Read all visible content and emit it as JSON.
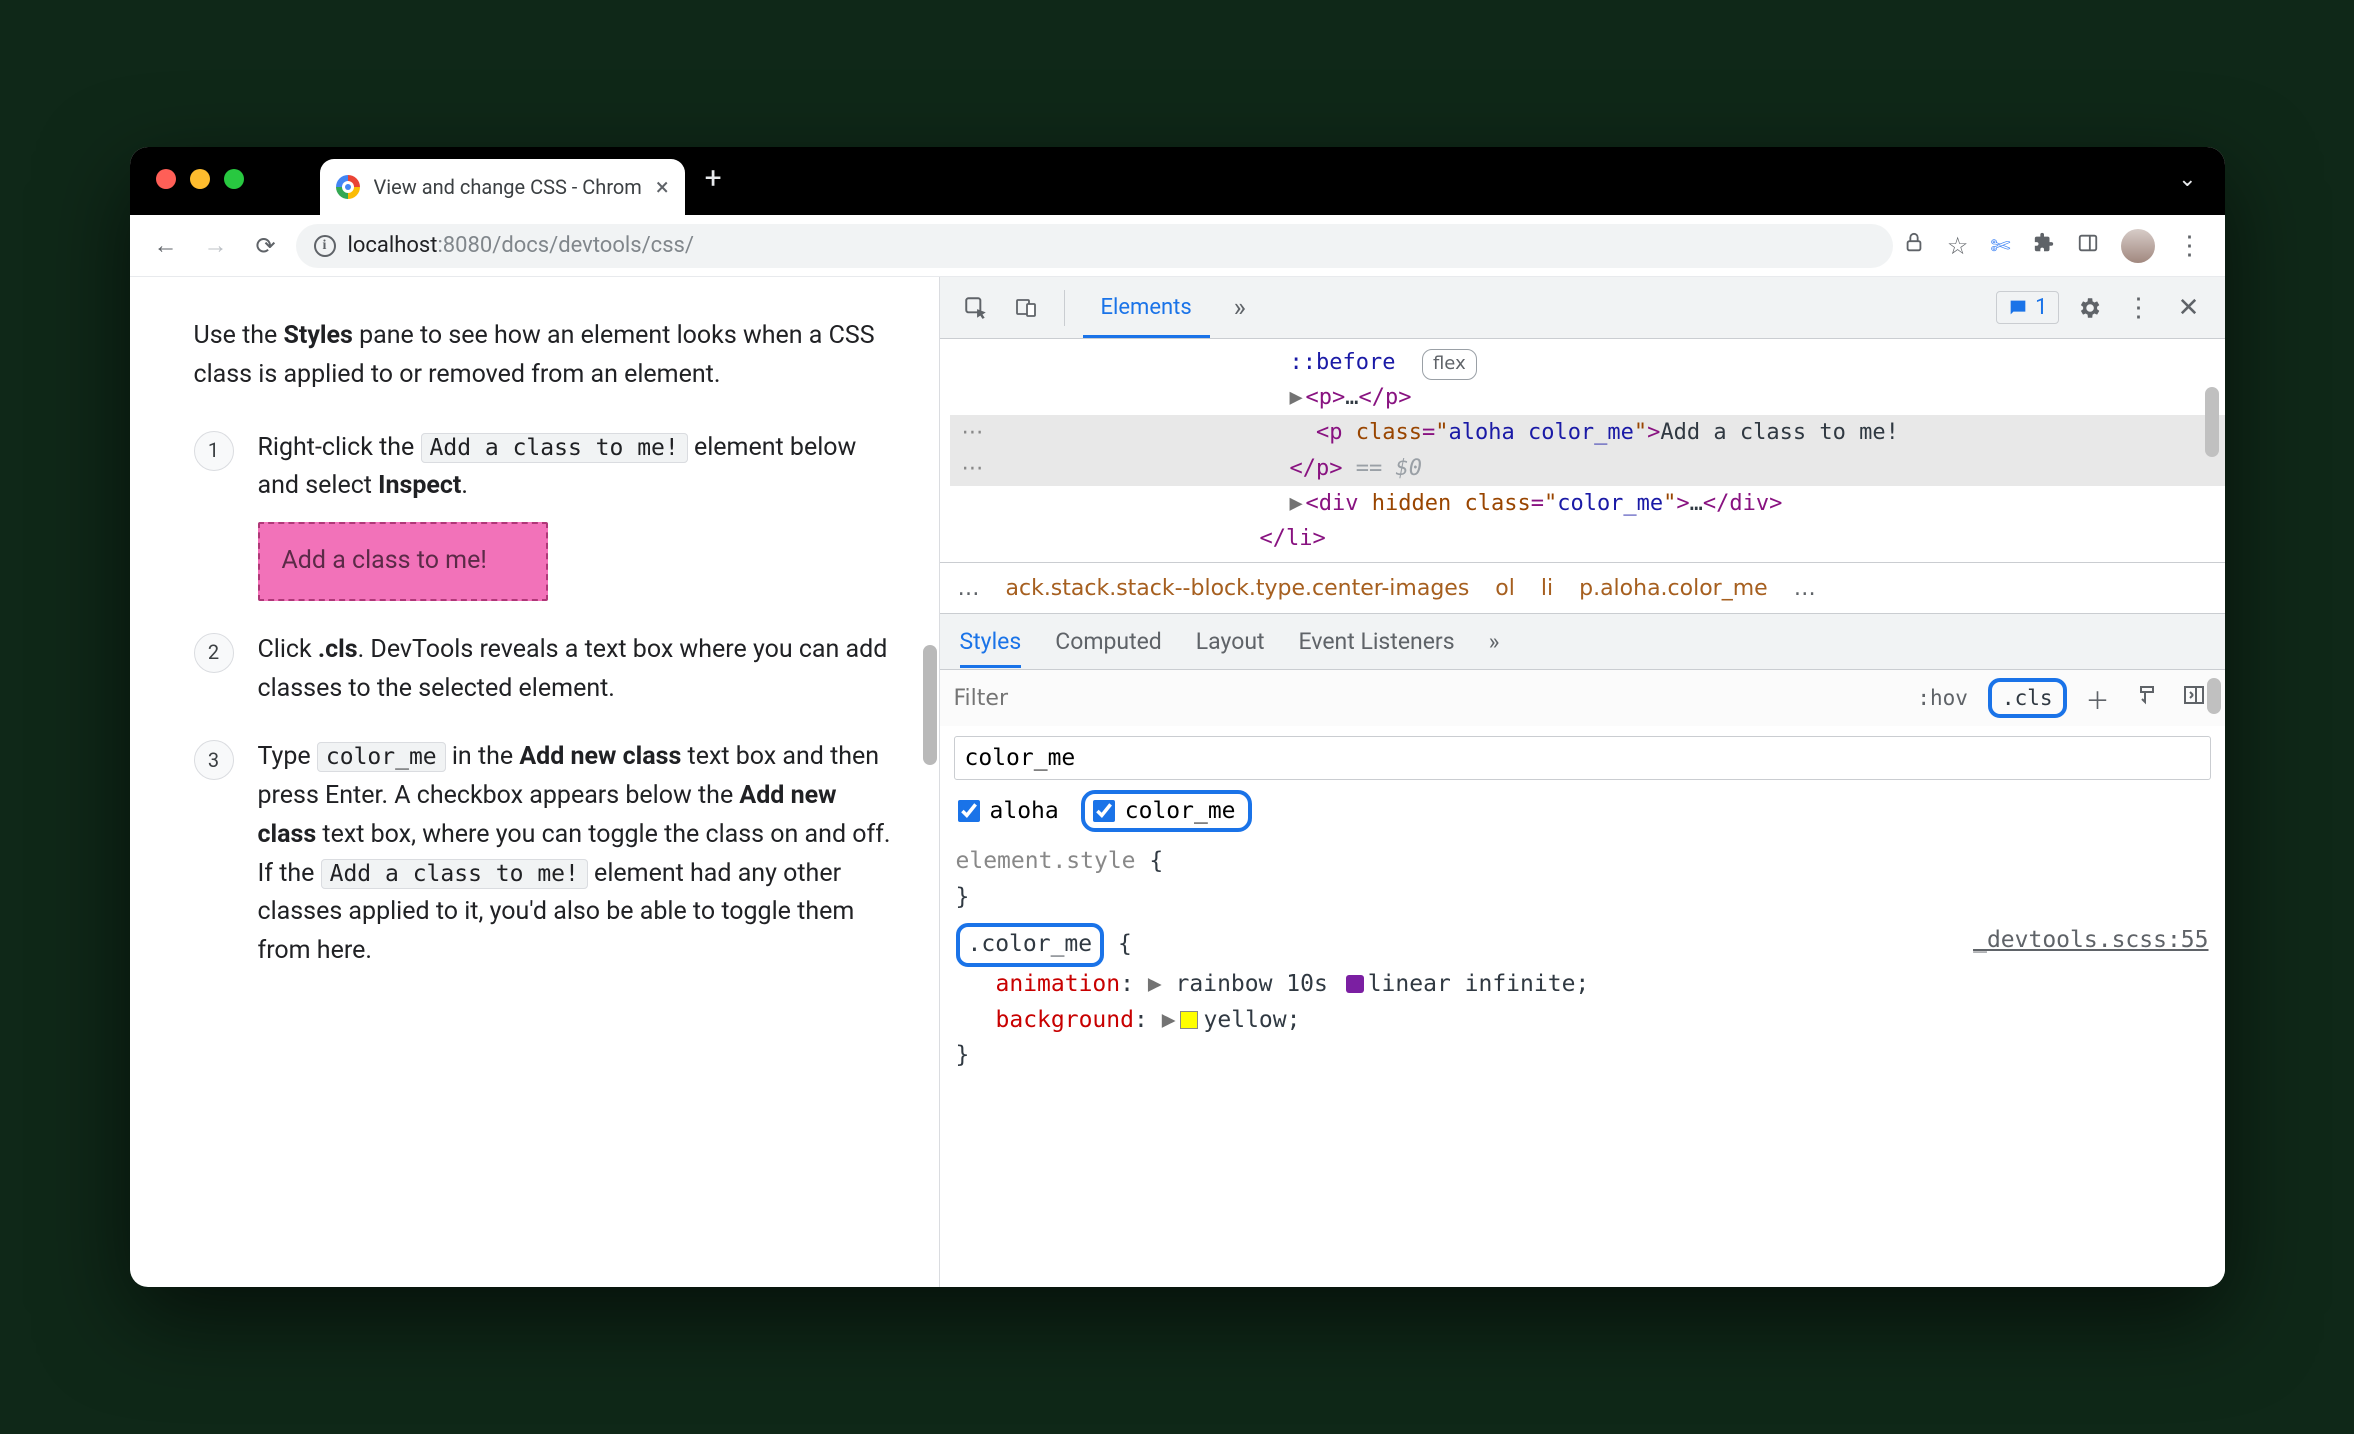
{
  "window": {
    "tab_title": "View and change CSS - Chrom",
    "url_host": "localhost",
    "url_port": ":8080",
    "url_path": "/docs/devtools/css/"
  },
  "page": {
    "intro_a": "Use the ",
    "intro_b": "Styles",
    "intro_c": " pane to see how an element looks when a CSS class is applied to or removed from an element.",
    "step1_a": "Right-click the ",
    "step1_code": "Add a class to me!",
    "step1_b": " element below and select ",
    "step1_bold": "Inspect",
    "demo_box": "Add a class to me!",
    "step2_a": "Click ",
    "step2_bold": ".cls",
    "step2_b": ". DevTools reveals a text box where you can add classes to the selected element.",
    "step3_a": "Type ",
    "step3_code1": "color_me",
    "step3_b": " in the ",
    "step3_bold1": "Add new class",
    "step3_c": " text box and then press Enter. A checkbox appears below the ",
    "step3_bold2": "Add new class",
    "step3_d": " text box, where you can toggle the class on and off. If the ",
    "step3_code2": "Add a class to me!",
    "step3_e": " element had any other classes applied to it, you'd also be able to toggle them from here."
  },
  "devtools": {
    "tab_elements": "Elements",
    "issue_count": "1",
    "dom": {
      "before_pseudo": "::before",
      "flex_badge": "flex",
      "p_collapsed": "…",
      "sel_open_tag": "p",
      "sel_attr_name": "class",
      "sel_attr_value": "aloha color_me",
      "sel_text": "Add a class to me!",
      "eq0": " == $0",
      "div_attr_hidden": "hidden",
      "div_attr_name": "class",
      "div_attr_value": "color_me",
      "div_collapsed": "…",
      "li_close": "li"
    },
    "crumbs": {
      "c1": "ack.stack.stack--block.type.center-images",
      "c2": "ol",
      "c3": "li",
      "c4": "p.aloha.color_me"
    },
    "subtabs": {
      "styles": "Styles",
      "computed": "Computed",
      "layout": "Layout",
      "events": "Event Listeners"
    },
    "filter_placeholder": "Filter",
    "hov": ":hov",
    "cls": ".cls",
    "cls_input": "color_me",
    "chk_aloha": "aloha",
    "chk_color_me": "color_me",
    "rules": {
      "elstyle": "element.style",
      "sel_color_me": ".color_me",
      "origin": "_devtools.scss:55",
      "prop_anim": "animation",
      "val_anim": "rainbow 10s ",
      "val_anim2": "linear infinite",
      "prop_bg": "background",
      "val_bg": "yellow"
    }
  }
}
